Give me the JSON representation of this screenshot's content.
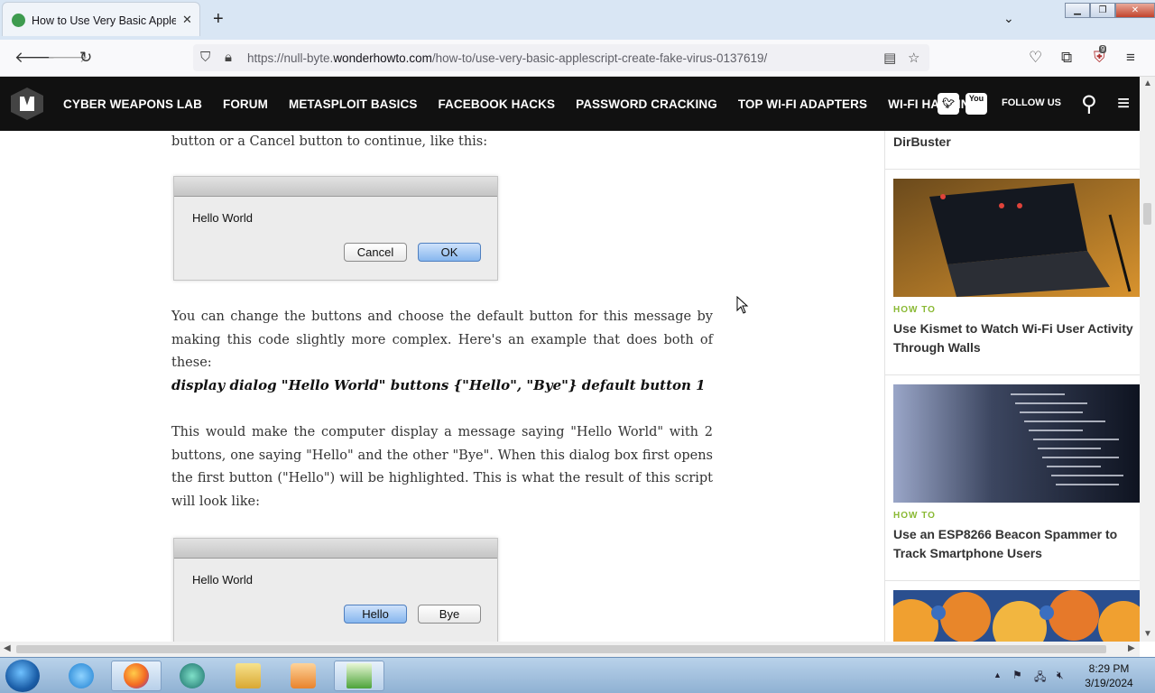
{
  "browser": {
    "tab_title": "How to Use Very Basic AppleScri",
    "tab_close": "✕",
    "new_tab": "+",
    "tab_list": "⌄",
    "url_prefix": "https://null-byte.",
    "url_domain": "wonderhowto.com",
    "url_path": "/how-to/use-very-basic-applescript-create-fake-virus-0137619/",
    "extension_badge": "9"
  },
  "site_nav": {
    "links": [
      "CYBER WEAPONS LAB",
      "FORUM",
      "METASPLOIT BASICS",
      "FACEBOOK HACKS",
      "PASSWORD CRACKING",
      "TOP WI-FI ADAPTERS",
      "WI-FI HACKING"
    ],
    "follow_us": "FOLLOW US",
    "youtube_label": "You"
  },
  "article": {
    "para1": "button or a Cancel button to continue, like this:",
    "dialog1": {
      "message": "Hello World",
      "btn1": "Cancel",
      "btn2": "OK"
    },
    "para2": "You can change the buttons and choose the default button for this message by making this code slightly more complex. Here's an example that does both of these:",
    "code": "display dialog \"Hello World\" buttons {\"Hello\", \"Bye\"} default button 1",
    "para3": "This would make the computer display a message saying \"Hello World\" with 2 buttons, one saying \"Hello\" and the other \"Bye\". When this dialog box first opens the first button (\"Hello\") will be highlighted. This is what the result of this script will look like:",
    "dialog2": {
      "message": "Hello World",
      "btn1": "Hello",
      "btn2": "Bye"
    }
  },
  "sidebar": {
    "top_title": "DirBuster",
    "items": [
      {
        "tag": "HOW TO",
        "title": "Use Kismet to Watch Wi-Fi User Activity Through Walls"
      },
      {
        "tag": "HOW TO",
        "title": "Use an ESP8266 Beacon Spammer to Track Smartphone Users"
      }
    ]
  },
  "taskbar": {
    "time": "8:29 PM",
    "date": "3/19/2024"
  },
  "colors": {
    "site_header": "#111111",
    "accent_green": "#8ab934",
    "default_button": "#86b6ee"
  }
}
